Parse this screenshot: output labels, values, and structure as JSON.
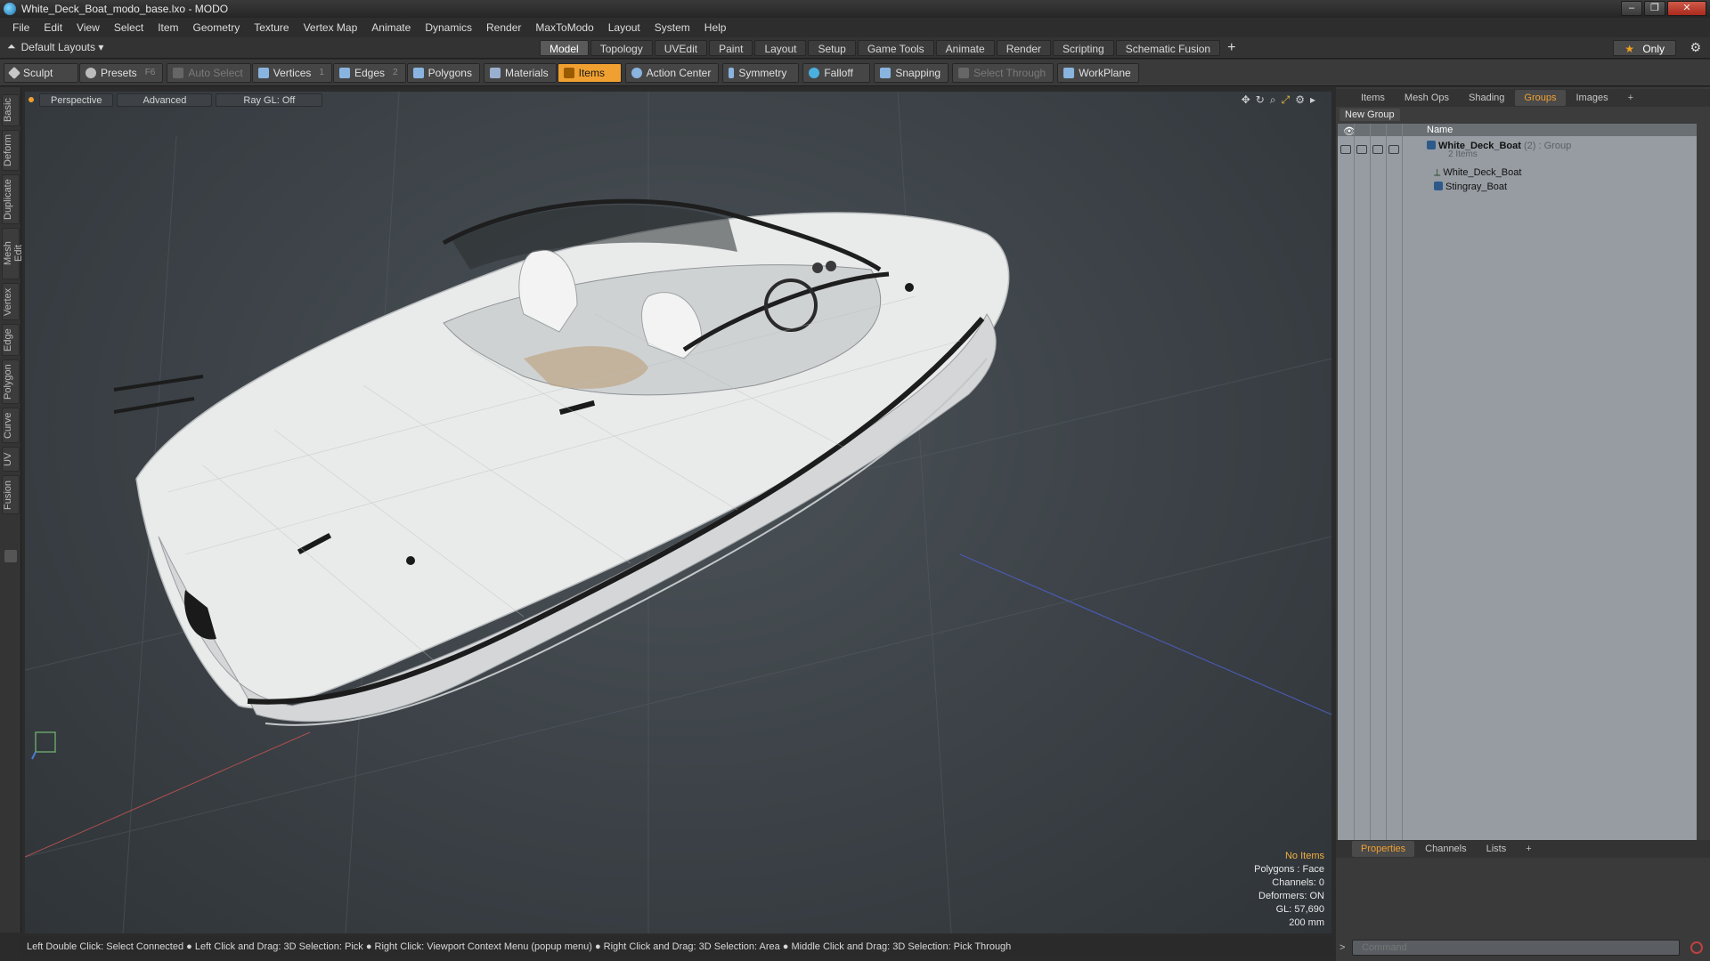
{
  "window": {
    "title": "White_Deck_Boat_modo_base.lxo - MODO",
    "buttons": [
      "–",
      "❐",
      "✕"
    ]
  },
  "menu": [
    "File",
    "Edit",
    "View",
    "Select",
    "Item",
    "Geometry",
    "Texture",
    "Vertex Map",
    "Animate",
    "Dynamics",
    "Render",
    "MaxToModo",
    "Layout",
    "System",
    "Help"
  ],
  "layouts": {
    "label": "Default Layouts ▾"
  },
  "layout_tabs": [
    "Model",
    "Topology",
    "UVEdit",
    "Paint",
    "Layout",
    "Setup",
    "Game Tools",
    "Animate",
    "Render",
    "Scripting",
    "Schematic Fusion"
  ],
  "active_layout_tab": "Model",
  "add_tab": "+",
  "only_button": {
    "star": "★",
    "label": "Only"
  },
  "toolbar": {
    "sculpt": "Sculpt",
    "presets": "Presets",
    "presets_key": "F6",
    "auto_select": "Auto Select",
    "vertices": "Vertices",
    "vertices_key": "1",
    "edges": "Edges",
    "edges_key": "2",
    "polygons": "Polygons",
    "materials": "Materials",
    "items": "Items",
    "action_center": "Action Center",
    "symmetry": "Symmetry",
    "falloff": "Falloff",
    "snapping": "Snapping",
    "select_through": "Select Through",
    "workplane": "WorkPlane"
  },
  "left_tabs": [
    "Basic",
    "Deform",
    "Duplicate",
    "Mesh Edit",
    "Vertex",
    "Edge",
    "Polygon",
    "Curve",
    "UV",
    "Fusion"
  ],
  "viewport": {
    "perspective": "Perspective",
    "advanced": "Advanced",
    "raygl": "Ray GL: Off",
    "info": {
      "items": "No Items",
      "polygons": "Polygons : Face",
      "channels": "Channels: 0",
      "deformers": "Deformers: ON",
      "gl": "GL: 57,690",
      "scale": "200 mm"
    }
  },
  "status_bar": "Left Double Click: Select Connected ● Left Click and Drag: 3D Selection: Pick ● Right Click: Viewport Context Menu (popup menu) ● Right Click and Drag: 3D Selection: Area ● Middle Click and Drag: 3D Selection: Pick Through",
  "right_tabs": [
    "Items",
    "Mesh Ops",
    "Shading",
    "Groups",
    "Images"
  ],
  "active_right_tab": "Groups",
  "groups": {
    "new_group": "New Group",
    "column_name": "Name",
    "root": {
      "name": "White_Deck_Boat",
      "count": "(2)",
      "type": ": Group",
      "sub": "2 Items"
    },
    "children": [
      "White_Deck_Boat",
      "Stingray_Boat"
    ]
  },
  "bottom_tabs": [
    "Properties",
    "Channels",
    "Lists"
  ],
  "active_bottom_tab": "Properties",
  "command": {
    "placeholder": "Command"
  },
  "colors": {
    "accent": "#f0a030",
    "viewport_bg": "#3b4146",
    "list_bg": "#969ca2"
  }
}
